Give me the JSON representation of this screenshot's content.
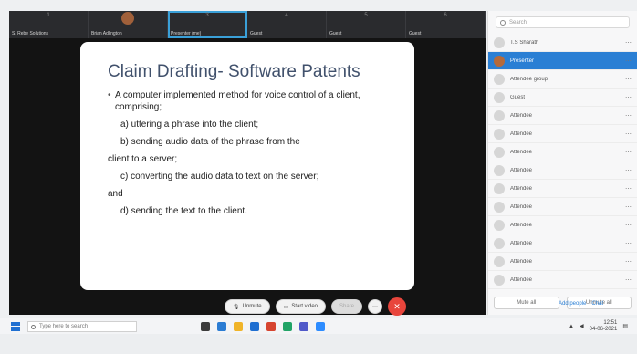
{
  "participants_strip": [
    {
      "num": "1",
      "name": "S. Rebe Solutions"
    },
    {
      "num": "2",
      "name": "Brian Adlington",
      "face": true
    },
    {
      "num": "3",
      "name": "Presenter (me)",
      "active": true
    },
    {
      "num": "4",
      "name": "Guest"
    },
    {
      "num": "5",
      "name": "Guest"
    },
    {
      "num": "6",
      "name": "Guest"
    }
  ],
  "slide": {
    "title": "Claim Drafting- Software Patents",
    "bullet": "A computer implemented method for voice control of a client, comprising;",
    "steps": [
      {
        "text": "a) uttering a phrase into the client;",
        "indent": true
      },
      {
        "text": "b) sending audio data of the phrase from the",
        "indent": true
      },
      {
        "text": "client to a server;",
        "indent": false
      },
      {
        "text": "c) converting the audio data to text on the server;",
        "indent": true
      },
      {
        "text": "and",
        "indent": false
      },
      {
        "text": "d) sending the text to the client.",
        "indent": true
      }
    ]
  },
  "controls": {
    "mute_label": "Unmute",
    "video_label": "Start video",
    "share_label": "Share",
    "more_label": "···"
  },
  "panel": {
    "search_placeholder": "Search",
    "rows": [
      {
        "label": "T.S Sharath",
        "selected": false
      },
      {
        "label": "Presenter",
        "selected": true
      },
      {
        "label": "Attendee group",
        "selected": false
      },
      {
        "label": "Guest",
        "selected": false
      },
      {
        "label": "Attendee",
        "selected": false
      },
      {
        "label": "Attendee",
        "selected": false
      },
      {
        "label": "Attendee",
        "selected": false
      },
      {
        "label": "Attendee",
        "selected": false
      },
      {
        "label": "Attendee",
        "selected": false
      },
      {
        "label": "Attendee",
        "selected": false
      },
      {
        "label": "Attendee",
        "selected": false
      },
      {
        "label": "Attendee",
        "selected": false
      },
      {
        "label": "Attendee",
        "selected": false
      },
      {
        "label": "Attendee",
        "selected": false
      }
    ],
    "mute_all": "Mute all",
    "unmute_all": "Unmute all"
  },
  "panel_links": {
    "left": "Add people",
    "right": "Chat"
  },
  "taskbar": {
    "search_placeholder": "Type here to search",
    "time": "12:51",
    "date": "04-06-2021"
  },
  "colors": {
    "accent": "#2a7fd4",
    "end_call": "#e8453c",
    "slide_title": "#41516c"
  }
}
